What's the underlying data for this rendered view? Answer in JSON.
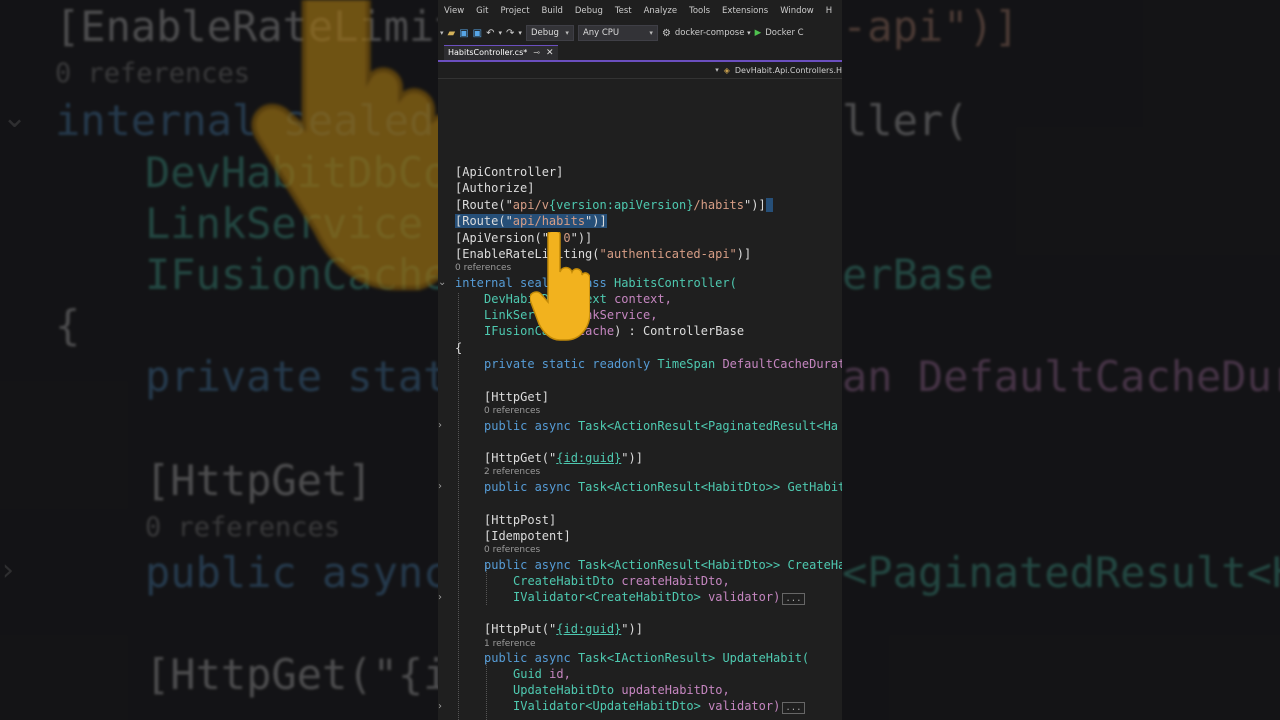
{
  "menu": [
    "View",
    "Git",
    "Project",
    "Build",
    "Debug",
    "Test",
    "Analyze",
    "Tools",
    "Extensions",
    "Window",
    "H"
  ],
  "toolbar": {
    "config": "Debug",
    "platform": "Any CPU",
    "project": "docker-compose",
    "run": "Docker C"
  },
  "tab": {
    "title": "HabitsController.cs*"
  },
  "navbar": {
    "path": "DevHabit.Api.Controllers.H"
  },
  "code": {
    "attr_api_controller": "[ApiController]",
    "attr_authorize": "[Authorize]",
    "route1_open": "[Route(\"",
    "route1_a": "api/v",
    "route1_b": "{version:apiVersion}",
    "route1_c": "/habits",
    "route1_close": "\")]",
    "route2_open": "[Route(\"",
    "route2_a": "api/habits",
    "route2_close": "\")]",
    "apiversion_open": "[ApiVersion(\"",
    "apiversion_val": "1.0",
    "apiversion_close": "\")]",
    "ratelimit_open": "[EnableRateLimiting(",
    "ratelimit_val": "\"authenticated-api\"",
    "ratelimit_close": ")]",
    "refs_0": "0 references",
    "refs_2": "2 references",
    "refs_1": "1 reference",
    "kw_internal": "internal",
    "kw_sealed": "sealed",
    "kw_class": "class",
    "class_name": "HabitsController(",
    "ctor_p1_type": "DevHabitDbContext",
    "ctor_p1_name": "context,",
    "ctor_p2_type": "LinkService",
    "ctor_p2_name": "linkService,",
    "ctor_p3_type": "IFusionCache",
    "ctor_p3_name": "cache",
    "ctor_base": ") : ControllerBase",
    "brace_open": "{",
    "field_mods": "private static readonly",
    "field_type": "TimeSpan",
    "field_name": "DefaultCacheDurati",
    "attr_httpget": "[HttpGet]",
    "m1_sig": "public async",
    "m1_ret": "Task<ActionResult<PaginatedResult<Ha",
    "attr_httpget_id_open": "[HttpGet(\"",
    "attr_httpget_id_val": "{id:guid}",
    "attr_httpget_id_close": "\")]",
    "m2_ret": "Task<ActionResult<HabitDto>>",
    "m2_name": "GetHabit",
    "attr_httppost": "[HttpPost]",
    "attr_idempotent": "[Idempotent]",
    "m3_ret": "Task<ActionResult<HabitDto>>",
    "m3_name": "CreateHa",
    "m3_p1_type": "CreateHabitDto",
    "m3_p1_name": "createHabitDto,",
    "m3_p2_type": "IValidator<CreateHabitDto>",
    "m3_p2_name": "validator)",
    "ellipsis": "...",
    "attr_httpput_open": "[HttpPut(\"",
    "attr_httpput_val": "{id:guid}",
    "attr_httpput_close": "\")]",
    "m4_ret": "Task<IActionResult>",
    "m4_name": "UpdateHabit(",
    "m4_p1_type": "Guid",
    "m4_p1_name": "id,",
    "m4_p2_type": "UpdateHabitDto",
    "m4_p2_name": "updateHabitDto,",
    "m4_p3_type": "IValidator<UpdateHabitDto>",
    "m4_p3_name": "validator)"
  },
  "background_left": {
    "l1": "[EnableRateLimiti",
    "l2": "0 references",
    "l3": "internal sealed",
    "l4": "DevHabitDbCon",
    "l5": "LinkService l",
    "l6": "IFusionCache ",
    "l7": "{",
    "l8": "private stati",
    "l9": "[HttpGet]",
    "l10": "0 references",
    "l11": "public async",
    "l12": "[HttpGet(\"{id"
  },
  "background_right": {
    "r1": "-api\")]",
    "r2": "ller(",
    "r3": "erBase",
    "r4": "an DefaultCacheDurat",
    "r5": "<PaginatedResult<Hab"
  },
  "colors": {
    "accent": "#6b4fbf",
    "keyword": "#569cd6",
    "type": "#4ec9b0",
    "string": "#d69d85",
    "selection": "#264f78"
  },
  "icons": [
    "open-folder-icon",
    "save-icon",
    "save-all-icon",
    "undo-icon",
    "redo-icon",
    "gear-icon",
    "play-icon",
    "pin-icon",
    "close-icon",
    "hand-pointer-icon"
  ]
}
